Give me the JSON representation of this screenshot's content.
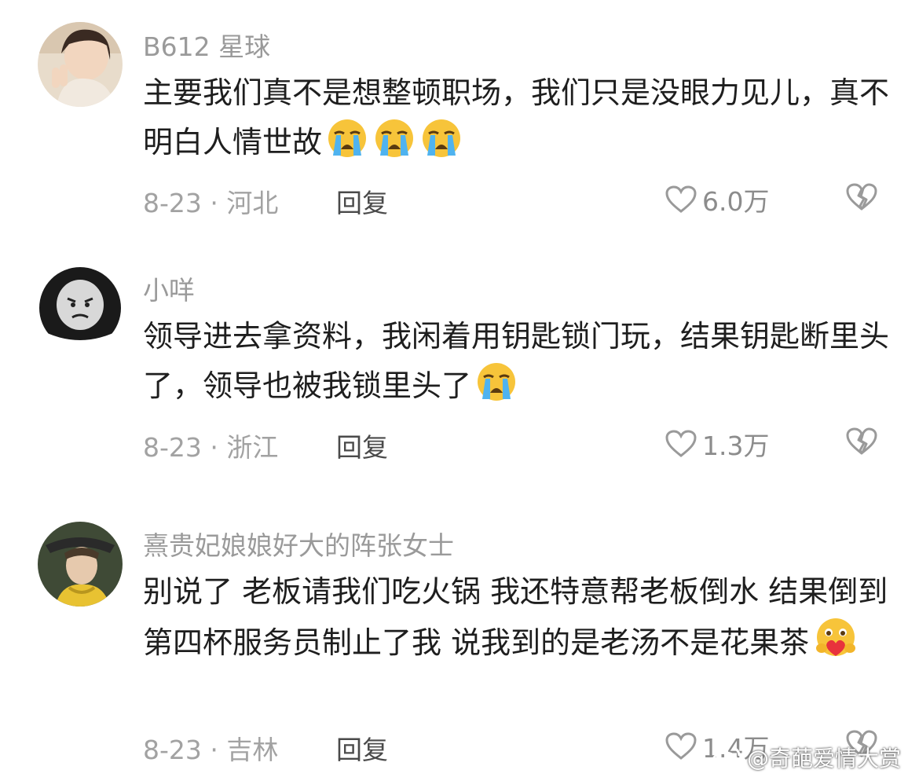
{
  "comments": [
    {
      "username": "B612 星球",
      "text": "主要我们真不是想整顿职场，我们只是没眼力见儿，真不明白人情世故",
      "emojis": [
        "loudly-crying-face",
        "loudly-crying-face",
        "loudly-crying-face"
      ],
      "date_location": "8-23 · 河北",
      "reply_label": "回复",
      "likes": "6.0万"
    },
    {
      "username": "小咩",
      "text": "领导进去拿资料，我闲着用钥匙锁门玩，结果钥匙断里头了，领导也被我锁里头了",
      "emojis": [
        "loudly-crying-face"
      ],
      "date_location": "8-23 · 浙江",
      "reply_label": "回复",
      "likes": "1.3万"
    },
    {
      "username": "熹贵妃娘娘好大的阵张女士",
      "text": "别说了 老板请我们吃火锅 我还特意帮老板倒水 结果倒到第四杯服务员制止了我 说我到的是老汤不是花果茶",
      "emojis": [
        "smiling-face-holding-heart"
      ],
      "date_location": "8-23 · 吉林",
      "reply_label": "回复",
      "likes": "1.4万"
    }
  ],
  "watermark": "@奇葩爱情大赏",
  "icons": {
    "like": "heart-outline-icon",
    "dislike": "broken-heart-icon",
    "watermark": "weibo-logo-icon"
  },
  "colors": {
    "username": "#9a9a9a",
    "body_text": "#1e1e1e",
    "meta_text": "#a2a2a2",
    "reply_text": "#4a4a4a",
    "emoji_yellow": "#f7c43a",
    "tear_blue": "#4fb3ef"
  }
}
